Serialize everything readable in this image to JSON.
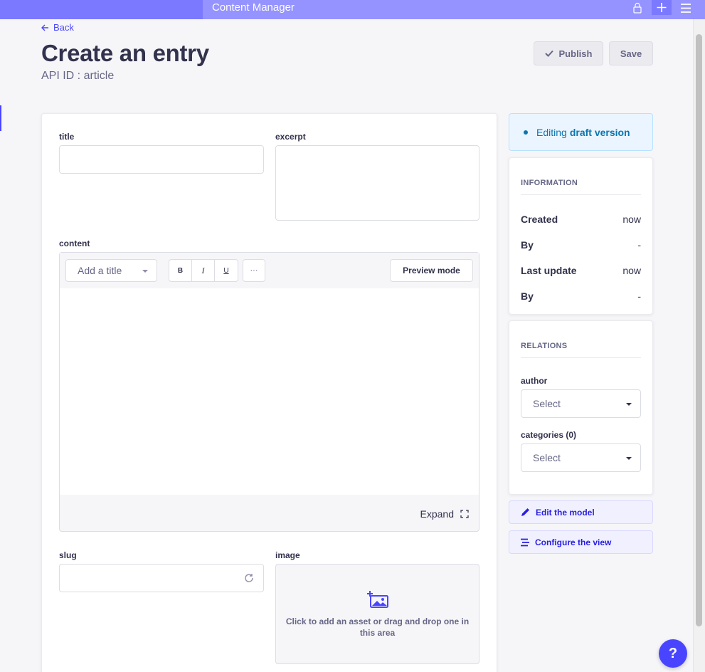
{
  "topbar": {
    "title": "Content Manager"
  },
  "header": {
    "back_label": "Back",
    "title": "Create an entry",
    "api_id": "API ID : article"
  },
  "actions": {
    "publish_label": "Publish",
    "save_label": "Save"
  },
  "fields": {
    "title": {
      "label": "title",
      "value": ""
    },
    "excerpt": {
      "label": "excerpt",
      "value": ""
    },
    "content": {
      "label": "content",
      "heading_select": "Add a title",
      "format_buttons": [
        "B",
        "I",
        "U"
      ],
      "more": "···",
      "preview_label": "Preview mode",
      "expand_label": "Expand"
    },
    "slug": {
      "label": "slug",
      "value": ""
    },
    "image": {
      "label": "image",
      "hint": "Click to add an asset or drag and drop one in this area"
    }
  },
  "status": {
    "prefix": "Editing",
    "strong": "draft version"
  },
  "information": {
    "title": "INFORMATION",
    "rows": [
      {
        "key": "Created",
        "value": "now"
      },
      {
        "key": "By",
        "value": "-"
      },
      {
        "key": "Last update",
        "value": "now"
      },
      {
        "key": "By",
        "value": "-"
      }
    ]
  },
  "relations": {
    "title": "RELATIONS",
    "author": {
      "label": "author",
      "placeholder": "Select"
    },
    "categories": {
      "label": "categories (0)",
      "placeholder": "Select"
    }
  },
  "links": {
    "edit_model": "Edit the model",
    "configure_view": "Configure the view"
  },
  "help": {
    "label": "?"
  },
  "colors": {
    "primary": "#4945ff",
    "topbar": "#7b79ff",
    "draft_text": "#0c75af"
  }
}
